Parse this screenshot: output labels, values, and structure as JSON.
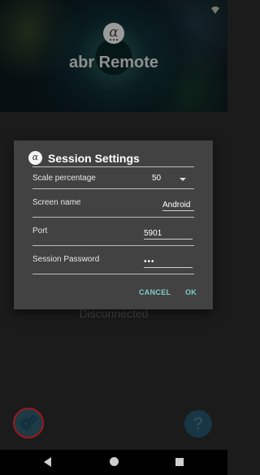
{
  "app": {
    "title": "abr Remote",
    "logo_icon": "alpha-logo-icon",
    "connection_status": "Disconnected"
  },
  "dialog": {
    "title": "Session Settings",
    "icon": "alpha-icon",
    "scale": {
      "label": "Scale percentage",
      "value": "50"
    },
    "screen_name": {
      "label": "Screen name",
      "value": "Android"
    },
    "port": {
      "label": "Port",
      "value": "5901"
    },
    "password": {
      "label": "Session Password",
      "value": "•••"
    },
    "cancel_label": "CANCEL",
    "ok_label": "OK"
  },
  "nav": {
    "back_icon": "back-icon",
    "home_icon": "home-icon",
    "recents_icon": "recents-icon"
  },
  "colors": {
    "dialog_bg": "#424242",
    "accent": "#7fcdc7",
    "settings_ring": "#9e1820",
    "help_fab": "#183644"
  }
}
